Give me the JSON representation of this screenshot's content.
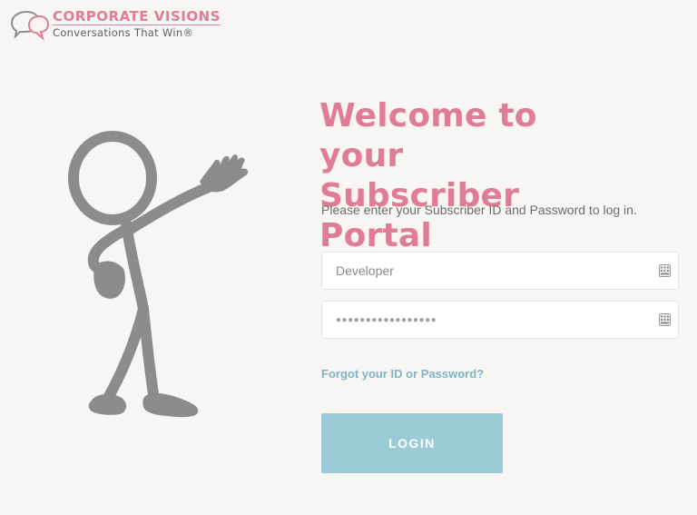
{
  "logo": {
    "name": "CORPORATE VISIONS",
    "tagline": "Conversations That Win®"
  },
  "heading": {
    "line1": "Welcome to your",
    "line2": "Subscriber Portal"
  },
  "instructions": "Please enter your Subscriber ID and Password to log in.",
  "form": {
    "username": {
      "value": "Developer",
      "icon": "keyboard-icon"
    },
    "password": {
      "value": "●●●●●●●●●●●●●●●●●",
      "icon": "keyboard-icon"
    },
    "forgot_link": "Forgot your ID or Password?",
    "login_label": "LOGIN"
  },
  "colors": {
    "brand_pink": "#e07c96",
    "accent_teal": "#9bcbd6",
    "link_blue": "#7fb3c5",
    "stickman_gray": "#8c8c8c",
    "background": "#f7f6f4"
  },
  "illustration": "stick-figure-waving"
}
